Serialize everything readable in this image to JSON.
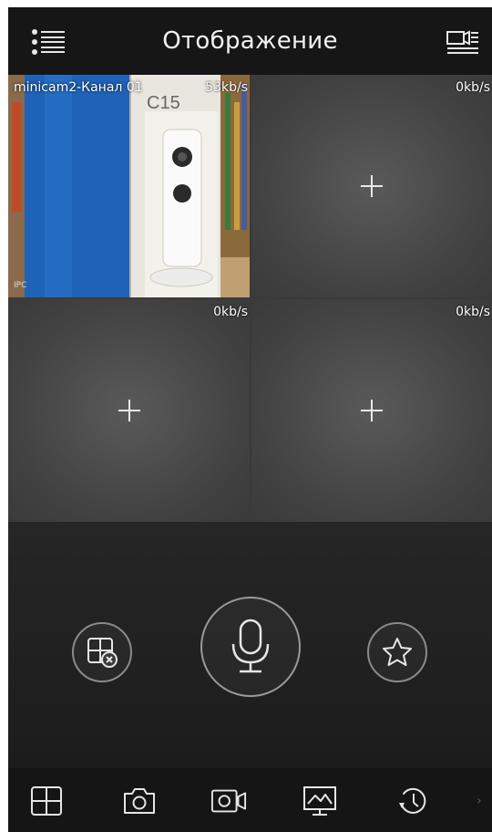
{
  "header": {
    "title": "Отображение",
    "menu_icon": "list-menu-icon",
    "right_icon": "device-list-icon"
  },
  "grid": {
    "cells": [
      {
        "channel": "minicam2-Канал 01",
        "rate": "53kb/s",
        "tag": "IPC",
        "brand": "C15"
      },
      {
        "rate": "0kb/s",
        "add_icon": "plus-icon"
      },
      {
        "rate": "0kb/s",
        "add_icon": "plus-icon"
      },
      {
        "rate": "0kb/s",
        "add_icon": "plus-icon"
      }
    ]
  },
  "controls": {
    "close_all_icon": "grid-close-icon",
    "talk_icon": "microphone-icon",
    "favorite_icon": "star-icon"
  },
  "toolbar": {
    "items": [
      {
        "icon": "split-screen-icon"
      },
      {
        "icon": "camera-snapshot-icon"
      },
      {
        "icon": "video-record-icon"
      },
      {
        "icon": "image-quality-icon"
      },
      {
        "icon": "playback-icon"
      }
    ],
    "more": "›"
  },
  "colors": {
    "background": "#1e1e1e",
    "header": "#161616",
    "cell": "#4a4a4a",
    "icon": "#e6e6e6"
  }
}
